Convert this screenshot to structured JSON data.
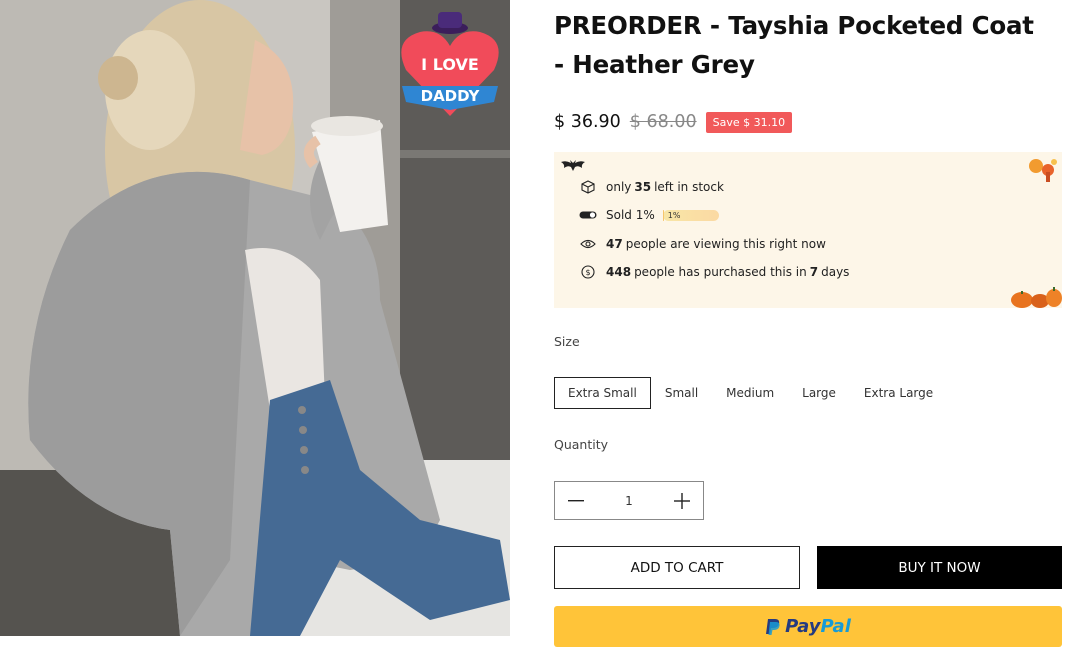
{
  "product": {
    "title": "PREORDER - Tayshia Pocketed Coat - Heather Grey",
    "price": "$ 36.90",
    "compare_price": "$ 68.00",
    "save_label": "Save $ 31.10",
    "image_badge_icon": "i-love-daddy-heart-badge"
  },
  "stock_info": {
    "stock": {
      "icon": "box-icon",
      "prefix": "only",
      "count": "35",
      "suffix": "left in stock"
    },
    "sold": {
      "icon": "toggle-icon",
      "label": "Sold 1%",
      "bar_label": "1%",
      "progress_percent": 1
    },
    "viewing": {
      "icon": "eye-icon",
      "count": "47",
      "suffix": "people are viewing this right now"
    },
    "purchased": {
      "icon": "dollar-coin-icon",
      "count": "448",
      "middle": "people has purchased this in",
      "days": "7",
      "suffix": "days"
    },
    "decorations": [
      "bat-icon",
      "halloween-pumpkins-icon",
      "lantern-icon"
    ]
  },
  "size": {
    "label": "Size",
    "options": [
      "Extra Small",
      "Small",
      "Medium",
      "Large",
      "Extra Large"
    ],
    "selected": "Extra Small"
  },
  "quantity": {
    "label": "Quantity",
    "value": "1"
  },
  "actions": {
    "add_to_cart": "ADD TO CART",
    "buy_now": "BUY IT NOW",
    "paypal_a": "Pay",
    "paypal_b": "Pal"
  },
  "colors": {
    "save_badge": "#f1595a",
    "info_bg": "#fdf6e8",
    "paypal_bg": "#ffc439",
    "buy_now_bg": "#000000"
  }
}
